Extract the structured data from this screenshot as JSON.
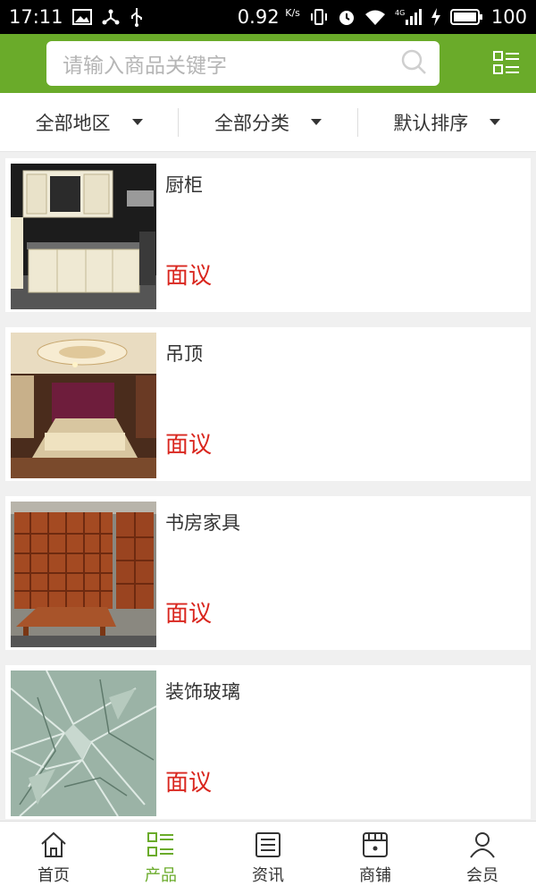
{
  "status_bar": {
    "time": "17:11",
    "speed": "0.92",
    "speed_unit": "K/s",
    "network": "4G",
    "battery": "100"
  },
  "search": {
    "placeholder": "请输入商品关键字"
  },
  "filters": [
    {
      "label": "全部地区"
    },
    {
      "label": "全部分类"
    },
    {
      "label": "默认排序"
    }
  ],
  "products": [
    {
      "title": "厨柜",
      "price": "面议",
      "image": "kitchen-cabinet"
    },
    {
      "title": "吊顶",
      "price": "面议",
      "image": "ceiling-bedroom"
    },
    {
      "title": "书房家具",
      "price": "面议",
      "image": "study-furniture"
    },
    {
      "title": "装饰玻璃",
      "price": "面议",
      "image": "decorative-glass"
    }
  ],
  "bottom_nav": {
    "active": 1,
    "items": [
      {
        "label": "首页",
        "icon": "home-icon"
      },
      {
        "label": "产品",
        "icon": "product-list-icon"
      },
      {
        "label": "资讯",
        "icon": "news-icon"
      },
      {
        "label": "商铺",
        "icon": "store-icon"
      },
      {
        "label": "会员",
        "icon": "user-icon"
      }
    ]
  },
  "colors": {
    "brand_green": "#6aab2a",
    "price_red": "#d9271f"
  }
}
